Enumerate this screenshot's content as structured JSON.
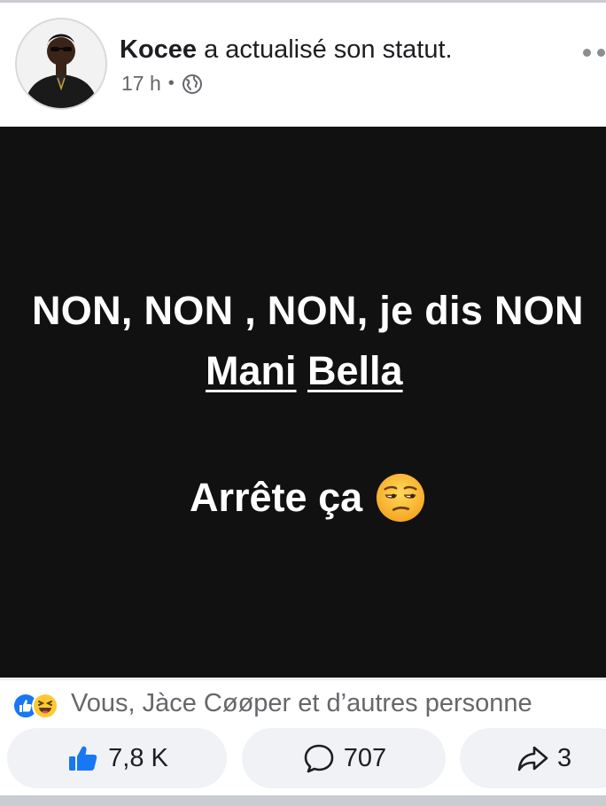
{
  "post": {
    "author": "Kocee",
    "action": " a actualisé son statut.",
    "time": "17 h",
    "separator": "•",
    "audience_icon": "globe-icon",
    "more_icon": "more-options-icon"
  },
  "image_text": {
    "line1": "NON, NON , NON, je dis NON",
    "name_first": "Mani",
    "name_last": "Bella",
    "line3": "Arrête ça",
    "emoji": "unamused-face-emoji"
  },
  "reactions": {
    "icons": [
      "like-reaction-icon",
      "haha-reaction-icon"
    ],
    "summary": "Vous, Jàce Cøøper et d’autres personne"
  },
  "actions": {
    "like_count": "7,8 K",
    "comment_count": "707",
    "share_count": "3"
  },
  "colors": {
    "brand_blue": "#1877f2",
    "image_background": "#111111",
    "button_background": "#f0f2f5",
    "secondary_text": "#65676b"
  }
}
